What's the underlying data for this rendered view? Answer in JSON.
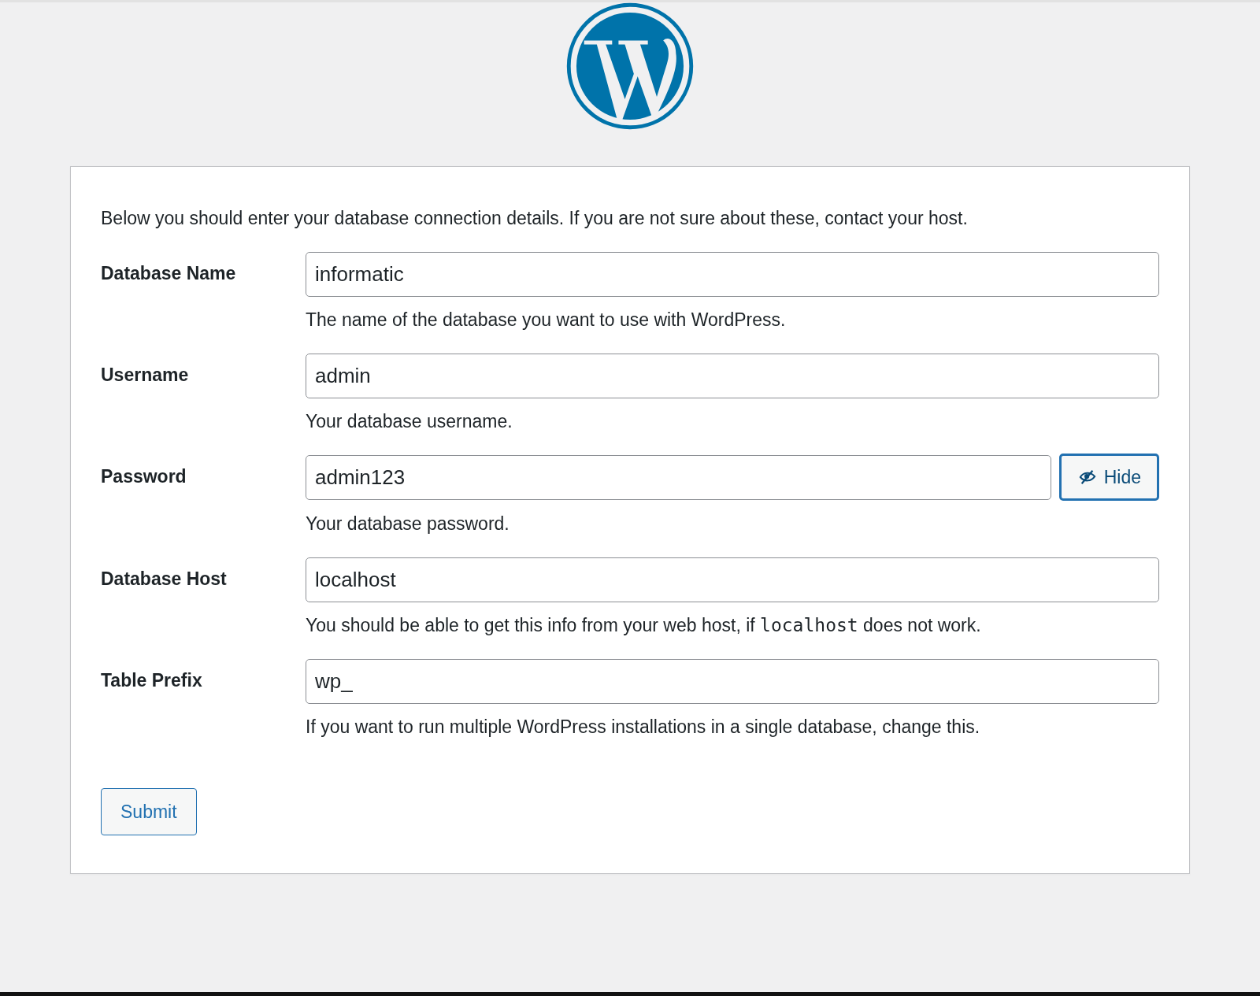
{
  "intro": "Below you should enter your database connection details. If you are not sure about these, contact your host.",
  "fields": [
    {
      "label": "Database Name",
      "value": "informatic",
      "description": [
        {
          "kind": "text",
          "text": "The name of the database you want to use with WordPress."
        }
      ]
    },
    {
      "label": "Username",
      "value": "admin",
      "description": [
        {
          "kind": "text",
          "text": "Your database username."
        }
      ]
    },
    {
      "label": "Password",
      "value": "admin123",
      "toggle": {
        "label": "Hide"
      },
      "description": [
        {
          "kind": "text",
          "text": "Your database password."
        }
      ]
    },
    {
      "label": "Database Host",
      "value": "localhost",
      "description": [
        {
          "kind": "text",
          "text": "You should be able to get this info from your web host, if "
        },
        {
          "kind": "code",
          "text": "localhost"
        },
        {
          "kind": "text",
          "text": " does not work."
        }
      ]
    },
    {
      "label": "Table Prefix",
      "value": "wp_",
      "description": [
        {
          "kind": "text",
          "text": "If you want to run multiple WordPress installations in a single database, change this."
        }
      ]
    }
  ],
  "submit": "Submit"
}
